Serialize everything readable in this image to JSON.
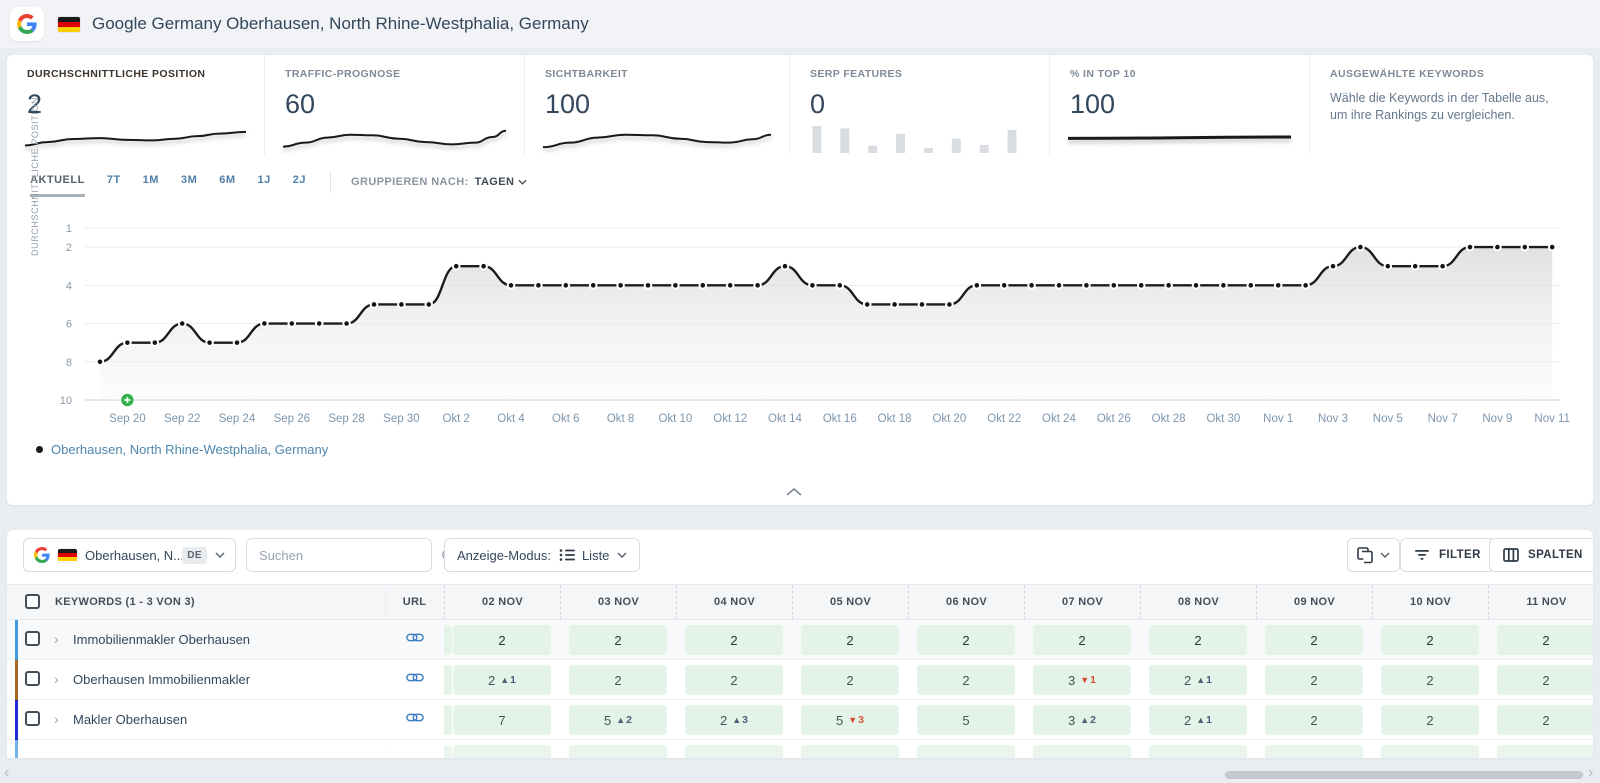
{
  "header": {
    "title": "Google Germany Oberhausen, North Rhine-Westphalia, Germany"
  },
  "summary_cards": [
    {
      "label": "DURCHSCHNITTLICHE POSITION",
      "value": "2",
      "spark_type": "line",
      "spark_points": [
        [
          0,
          80
        ],
        [
          10,
          68
        ],
        [
          22,
          57
        ],
        [
          34,
          54
        ],
        [
          46,
          60
        ],
        [
          58,
          62
        ],
        [
          68,
          56
        ],
        [
          78,
          47
        ],
        [
          88,
          38
        ],
        [
          100,
          32
        ]
      ]
    },
    {
      "label": "TRAFFIC-PROGNOSE",
      "value": "60",
      "spark_type": "line",
      "spark_points": [
        [
          0,
          84
        ],
        [
          10,
          70
        ],
        [
          20,
          52
        ],
        [
          30,
          42
        ],
        [
          40,
          44
        ],
        [
          52,
          56
        ],
        [
          64,
          68
        ],
        [
          76,
          76
        ],
        [
          86,
          70
        ],
        [
          94,
          50
        ],
        [
          100,
          28
        ]
      ]
    },
    {
      "label": "SICHTBARKEIT",
      "value": "100",
      "spark_type": "line",
      "spark_points": [
        [
          0,
          86
        ],
        [
          12,
          70
        ],
        [
          24,
          52
        ],
        [
          36,
          42
        ],
        [
          48,
          44
        ],
        [
          60,
          56
        ],
        [
          72,
          68
        ],
        [
          82,
          70
        ],
        [
          92,
          58
        ],
        [
          100,
          42
        ]
      ]
    },
    {
      "label": "SERP FEATURES",
      "value": "0",
      "spark_type": "bars",
      "spark_bars": [
        66,
        60,
        16,
        46,
        10,
        34,
        18,
        56
      ]
    },
    {
      "label": "% IN TOP 10",
      "value": "100",
      "spark_type": "flat",
      "spark_points": [
        [
          0,
          55
        ],
        [
          100,
          50
        ]
      ]
    },
    {
      "label": "AUSGEWÄHLTE KEYWORDS",
      "description": "Wähle die Keywords in der Tabelle aus, um ihre Rankings zu vergleichen."
    }
  ],
  "period_tabs": {
    "items": [
      "AKTUELL",
      "7T",
      "1M",
      "3M",
      "6M",
      "1J",
      "2J"
    ],
    "active_index": 0,
    "group_by_label": "GRUPPIEREN NACH:",
    "group_by_value": "TAGEN"
  },
  "chart_data": {
    "type": "line",
    "y_axis_label": "DURCHSCHNITTLICHE POSITION",
    "y_ticks": [
      1,
      2,
      4,
      6,
      8,
      10
    ],
    "y_inverted": true,
    "ylim": [
      1,
      10
    ],
    "grid": true,
    "x": [
      "Sep 19",
      "Sep 20",
      "Sep 21",
      "Sep 22",
      "Sep 23",
      "Sep 24",
      "Sep 25",
      "Sep 26",
      "Sep 27",
      "Sep 28",
      "Sep 29",
      "Sep 30",
      "Okt 1",
      "Okt 2",
      "Okt 3",
      "Okt 4",
      "Okt 5",
      "Okt 6",
      "Okt 7",
      "Okt 8",
      "Okt 9",
      "Okt 10",
      "Okt 11",
      "Okt 12",
      "Okt 13",
      "Okt 14",
      "Okt 15",
      "Okt 16",
      "Okt 17",
      "Okt 18",
      "Okt 19",
      "Okt 20",
      "Okt 21",
      "Okt 22",
      "Okt 23",
      "Okt 24",
      "Okt 25",
      "Okt 26",
      "Okt 27",
      "Okt 28",
      "Okt 29",
      "Okt 30",
      "Okt 31",
      "Nov 1",
      "Nov 2",
      "Nov 3",
      "Nov 4",
      "Nov 5",
      "Nov 6",
      "Nov 7",
      "Nov 8",
      "Nov 9",
      "Nov 10",
      "Nov 11"
    ],
    "x_tick_start": 1,
    "x_tick_step": 2,
    "series": [
      {
        "name": "Oberhausen, North Rhine-Westphalia, Germany",
        "color": "#1c1c1c",
        "values": [
          8,
          7,
          7,
          6,
          7,
          7,
          6,
          6,
          6,
          6,
          5,
          5,
          5,
          3,
          3,
          4,
          4,
          4,
          4,
          4,
          4,
          4,
          4,
          4,
          4,
          3,
          4,
          4,
          5,
          5,
          5,
          5,
          4,
          4,
          4,
          4,
          4,
          4,
          4,
          4,
          4,
          4,
          4,
          4,
          4,
          3,
          2,
          3,
          3,
          3,
          2,
          2,
          2,
          2
        ]
      }
    ],
    "annotations": [
      {
        "type": "note-marker",
        "x": "Sep 20",
        "color": "#35b34a",
        "icon": "plus-circle-icon"
      }
    ]
  },
  "chart_legend": {
    "label": "Oberhausen, North Rhine-Westphalia, Germany"
  },
  "table": {
    "toolbar": {
      "location": {
        "label": "Oberhausen, N...",
        "lang_badge": "DE"
      },
      "search_placeholder": "Suchen",
      "display_mode_label": "Anzeige-Modus:",
      "display_mode_value": "Liste",
      "filter_label": "FILTER",
      "columns_label": "SPALTEN"
    },
    "header": {
      "keywords": "KEYWORDS (1 - 3 VON 3)",
      "url": "URL",
      "dates": [
        "02 NOV",
        "03 NOV",
        "04 NOV",
        "05 NOV",
        "06 NOV",
        "07 NOV",
        "08 NOV",
        "09 NOV",
        "10 NOV",
        "11 NOV"
      ]
    },
    "rows": [
      {
        "tag_color": "#3f9ae0",
        "keyword": "Immobilienmakler Oberhausen",
        "cells": [
          {
            "v": "2"
          },
          {
            "v": "2"
          },
          {
            "v": "2"
          },
          {
            "v": "2"
          },
          {
            "v": "2"
          },
          {
            "v": "2"
          },
          {
            "v": "2"
          },
          {
            "v": "2"
          },
          {
            "v": "2"
          },
          {
            "v": "2"
          }
        ]
      },
      {
        "tag_color": "#a8681f",
        "keyword": "Oberhausen Immobilienmakler",
        "cells": [
          {
            "v": "2",
            "dir": "up",
            "delta": "1"
          },
          {
            "v": "2"
          },
          {
            "v": "2"
          },
          {
            "v": "2"
          },
          {
            "v": "2"
          },
          {
            "v": "3",
            "dir": "down",
            "delta": "1"
          },
          {
            "v": "2",
            "dir": "up",
            "delta": "1"
          },
          {
            "v": "2"
          },
          {
            "v": "2"
          },
          {
            "v": "2"
          }
        ]
      },
      {
        "tag_color": "#1f2bd6",
        "keyword": "Makler Oberhausen",
        "cells": [
          {
            "v": "7"
          },
          {
            "v": "5",
            "dir": "up",
            "delta": "2"
          },
          {
            "v": "2",
            "dir": "up",
            "delta": "3"
          },
          {
            "v": "5",
            "dir": "down",
            "delta": "3"
          },
          {
            "v": "5"
          },
          {
            "v": "3",
            "dir": "up",
            "delta": "2"
          },
          {
            "v": "2",
            "dir": "up",
            "delta": "1"
          },
          {
            "v": "2"
          },
          {
            "v": "2"
          },
          {
            "v": "2"
          }
        ]
      }
    ]
  },
  "colors": {
    "cell_green": "#e4f3e7",
    "up": "#4a6076",
    "down": "#cf5334",
    "accent_link": "#3e7fc1",
    "note_marker": "#35b34a"
  }
}
